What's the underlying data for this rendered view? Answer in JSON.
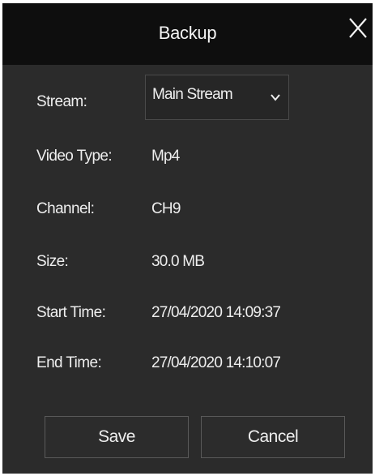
{
  "dialog": {
    "title": "Backup",
    "close_icon": "close-icon"
  },
  "stream": {
    "label": "Stream:",
    "selected": "Main Stream",
    "chevron_icon": "chevron-down-icon"
  },
  "fields": {
    "video_type": {
      "label": "Video Type:",
      "value": "Mp4"
    },
    "channel": {
      "label": "Channel:",
      "value": "CH9"
    },
    "size": {
      "label": "Size:",
      "value": "30.0 MB"
    },
    "start_time": {
      "label": "Start Time:",
      "value": "27/04/2020 14:09:37"
    },
    "end_time": {
      "label": "End Time:",
      "value": "27/04/2020 14:10:07"
    }
  },
  "buttons": {
    "save": "Save",
    "cancel": "Cancel"
  },
  "colors": {
    "titlebar": "#0e0e0e",
    "background": "#2b2b2b",
    "text": "#eeeeee",
    "border": "#5a5a5a"
  }
}
